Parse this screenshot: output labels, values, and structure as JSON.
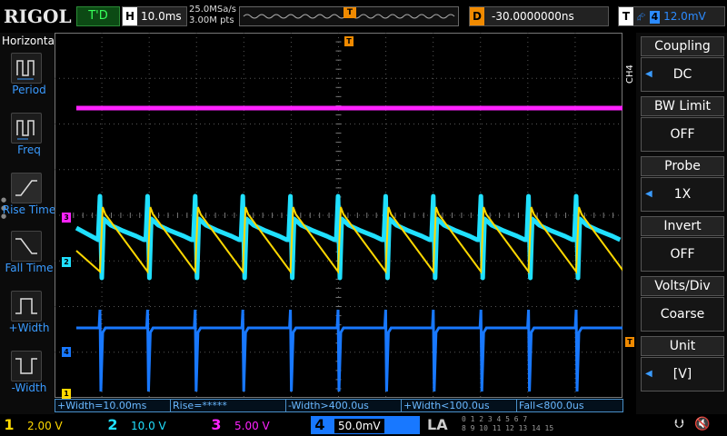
{
  "brand": "RIGOL",
  "status": {
    "run_state": "T'D"
  },
  "horizontal": {
    "key": "H",
    "timebase": "10.0ms",
    "sample_rate": "25.0MSa/s",
    "memory_depth": "3.00M pts"
  },
  "delay": {
    "key": "D",
    "value": "-30.0000000ns"
  },
  "trigger": {
    "key": "T",
    "edge_icon": "rising-edge-icon",
    "source": "4",
    "level": "12.0mV"
  },
  "left_menu": {
    "title": "Horizontal",
    "items": [
      {
        "label": "Period",
        "icon": "period-icon"
      },
      {
        "label": "Freq",
        "icon": "freq-icon"
      },
      {
        "label": "Rise Time",
        "icon": "rise-time-icon"
      },
      {
        "label": "Fall Time",
        "icon": "fall-time-icon"
      },
      {
        "label": "+Width",
        "icon": "positive-width-icon"
      },
      {
        "label": "-Width",
        "icon": "negative-width-icon"
      }
    ]
  },
  "right_menu": {
    "channel": "CH4",
    "items": [
      {
        "label": "Coupling",
        "value": "DC"
      },
      {
        "label": "BW Limit",
        "value": "OFF"
      },
      {
        "label": "Probe",
        "value": "1X"
      },
      {
        "label": "Invert",
        "value": "OFF"
      },
      {
        "label": "Volts/Div",
        "value": "Coarse"
      },
      {
        "label": "Unit",
        "value": "[V]"
      }
    ]
  },
  "channel_markers": [
    {
      "label": "3",
      "color": "#ff22ff"
    },
    {
      "label": "2",
      "color": "#20e0ff"
    },
    {
      "label": "4",
      "color": "#1878ff"
    },
    {
      "label": "1",
      "color": "#ffd800"
    }
  ],
  "measurements": [
    "+Width=10.00ms",
    "Rise=*****",
    "-Width>400.0us",
    "+Width<100.0us",
    "Fall<800.0us"
  ],
  "channels": [
    {
      "number": "1",
      "scale": "2.00 V",
      "color": "#ffd800"
    },
    {
      "number": "2",
      "scale": "10.0 V",
      "color": "#20e0ff"
    },
    {
      "number": "3",
      "scale": "5.00 V",
      "color": "#ff22ff"
    },
    {
      "number": "4",
      "scale": "50.0mV",
      "color": "#1878ff"
    }
  ],
  "la_label": "LA",
  "la_digits": [
    "0 1 2 3   4 5 6 7",
    "8 9 10 11 12 13 14 15"
  ],
  "colors": {
    "ch1": "#ffd800",
    "ch2": "#20e0ff",
    "ch3": "#ff22ff",
    "ch4": "#1878ff",
    "trigger": "#f08a00",
    "grid": "#555555"
  }
}
